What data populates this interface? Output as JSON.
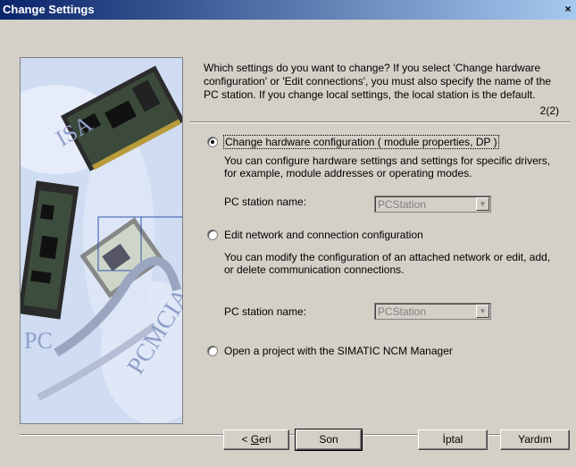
{
  "window": {
    "title": "Change Settings",
    "close_glyph": "×"
  },
  "intro": {
    "text": "Which settings do you want to change? If you select 'Change hardware configuration' or 'Edit connections', you must also specify the name of the PC station. If you change local settings, the local station is the default.",
    "page": "2(2)"
  },
  "options": [
    {
      "label": "Change hardware configuration ( module properties, DP )",
      "selected": true,
      "description": "You can configure hardware settings and settings for specific drivers, for example, module addresses or operating modes.",
      "pc_label": "PC station name:",
      "pc_value": "PCStation"
    },
    {
      "label": "Edit network and connection configuration",
      "selected": false,
      "description": "You can modify the configuration of an attached network or edit, add, or delete communication connections.",
      "pc_label": "PC station name:",
      "pc_value": "PCStation"
    },
    {
      "label": "Open a project with the SIMATIC NCM Manager",
      "selected": false
    }
  ],
  "art": {
    "labels": [
      "ISA",
      "PCMCIA",
      "PC"
    ]
  },
  "buttons": {
    "back_prefix": "< ",
    "back_key": "G",
    "back_rest": "eri",
    "finish": "Son",
    "cancel": "İptal",
    "help": "Yardım"
  }
}
